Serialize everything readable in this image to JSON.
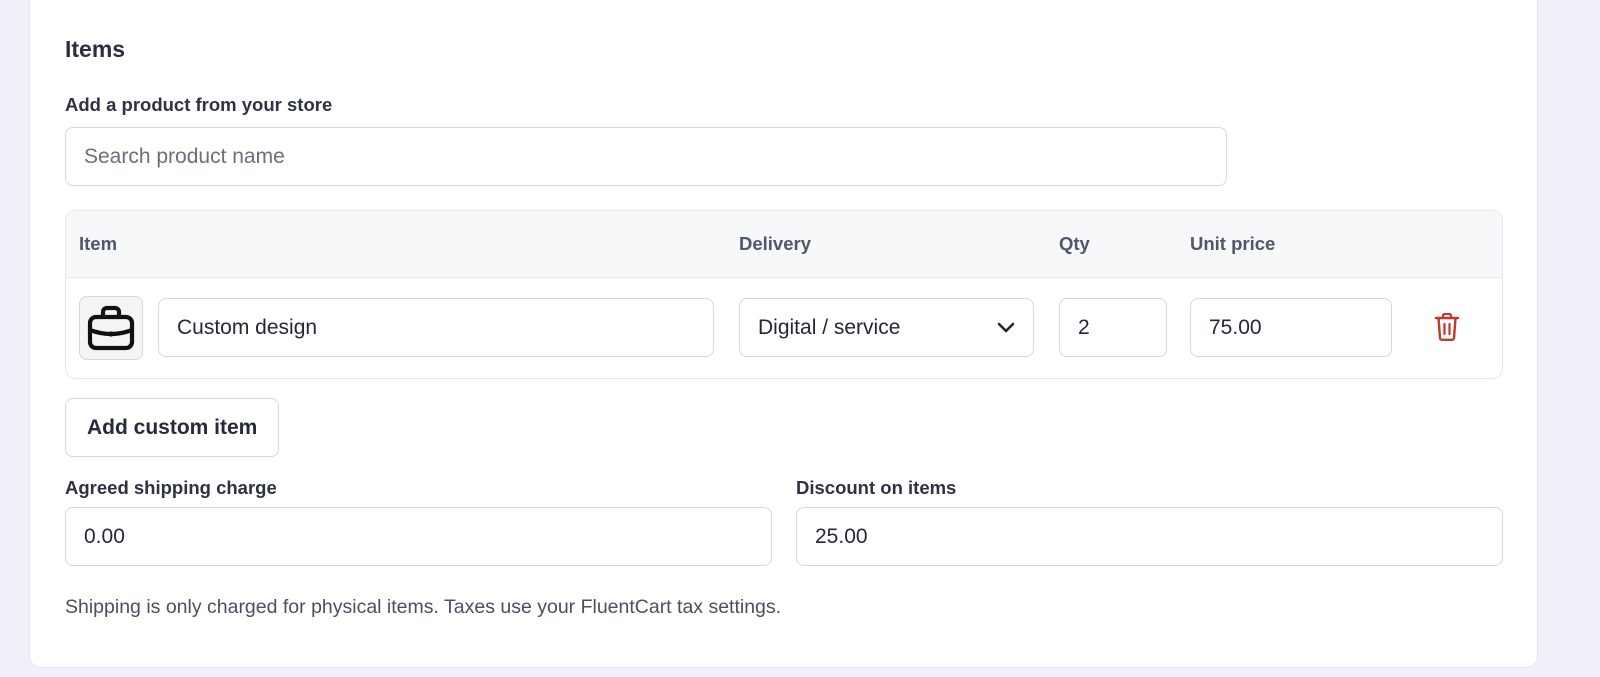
{
  "section": {
    "title": "Items"
  },
  "product_search": {
    "label": "Add a product from your store",
    "placeholder": "Search product name",
    "value": ""
  },
  "table": {
    "headers": {
      "item": "Item",
      "delivery": "Delivery",
      "qty": "Qty",
      "unit_price": "Unit price"
    },
    "rows": [
      {
        "icon": "briefcase-icon",
        "name": "Custom design",
        "delivery": "Digital / service",
        "qty": "2",
        "unit_price": "75.00"
      }
    ]
  },
  "add_custom_item": {
    "label": "Add custom item"
  },
  "shipping": {
    "label": "Agreed shipping charge",
    "value": "0.00"
  },
  "discount": {
    "label": "Discount on items",
    "value": "25.00"
  },
  "note": "Shipping is only charged for physical items. Taxes use your FluentCart tax settings.",
  "colors": {
    "background": "#f0f1f8",
    "card": "#ffffff",
    "border": "#d5d7de",
    "delete": "#c0392b"
  }
}
